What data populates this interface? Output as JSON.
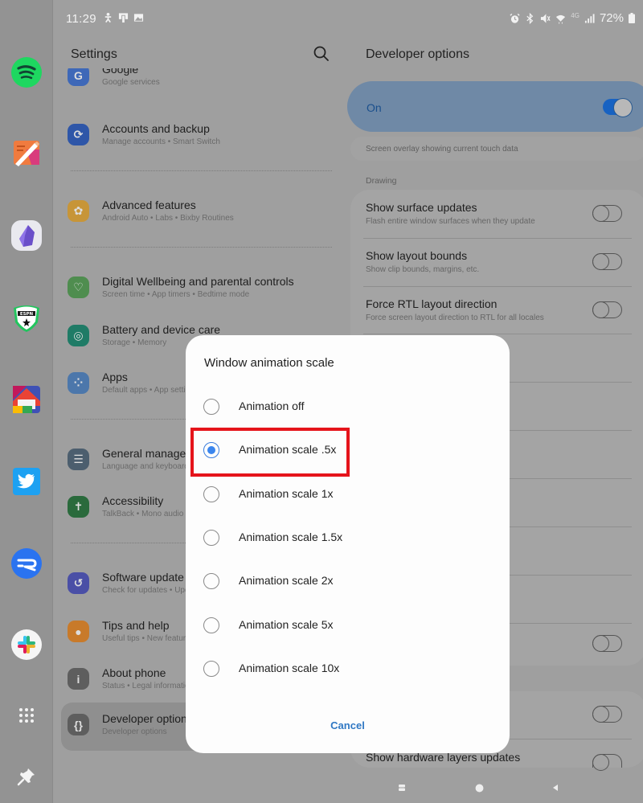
{
  "status_bar": {
    "time": "11:29",
    "left_icons": [
      "accessibility-notification-icon",
      "device-notification-icon",
      "gallery-notification-icon"
    ],
    "right_icons": [
      "alarm-icon",
      "bluetooth-icon",
      "mute-icon",
      "wifi-icon",
      "4g-icon",
      "signal-icon"
    ],
    "network_label": "4G",
    "battery": "72%"
  },
  "taskbar": {
    "apps": [
      {
        "name": "spotify",
        "icon": "spotify-icon",
        "color": "#1ed760"
      },
      {
        "name": "notes",
        "icon": "notes-pencil-icon",
        "color": "#f07b3f"
      },
      {
        "name": "obsidian",
        "icon": "obsidian-icon",
        "color": "#7c5cd6"
      },
      {
        "name": "espn-fantasy",
        "icon": "espn-shield-icon",
        "color": "#e8eaf0"
      },
      {
        "name": "home-launcher",
        "icon": "home-icon",
        "color": "#e94335"
      },
      {
        "name": "twitter",
        "icon": "twitter-bird-icon",
        "color": "#1da1f2"
      },
      {
        "name": "relay",
        "icon": "relay-r-icon",
        "color": "#2a73f0"
      },
      {
        "name": "slack",
        "icon": "slack-icon",
        "color": "#ffffff"
      }
    ],
    "all_apps_icon": "app-grid-icon",
    "pin_icon": "pin-icon"
  },
  "settings": {
    "title": "Settings",
    "search_icon": "search-icon",
    "items": [
      {
        "title": "Google",
        "subtitle": "Google services",
        "icon": "google-icon",
        "color": "#3e68b8"
      },
      {
        "title": "Accounts and backup",
        "subtitle": "Manage accounts  •  Smart Switch",
        "icon": "sync-icon",
        "color": "#2e56a8"
      },
      {
        "title": "Advanced features",
        "subtitle": "Android Auto  •  Labs  •  Bixby Routines",
        "icon": "gear-plus-icon",
        "color": "#c79538"
      },
      {
        "title": "Digital Wellbeing and parental controls",
        "subtitle": "Screen time  •  App timers  •  Bedtime mode",
        "icon": "wellbeing-icon",
        "color": "#4f8d4f"
      },
      {
        "title": "Battery and device care",
        "subtitle": "Storage  •  Memory",
        "icon": "device-care-icon",
        "color": "#1f7b66"
      },
      {
        "title": "Apps",
        "subtitle": "Default apps  •  App settings",
        "icon": "apps-icon",
        "color": "#4c77ab"
      },
      {
        "title": "General management",
        "subtitle": "Language and keyboard",
        "icon": "sliders-icon",
        "color": "#4c5e6e"
      },
      {
        "title": "Accessibility",
        "subtitle": "TalkBack  •  Mono audio",
        "icon": "accessibility-icon",
        "color": "#2a6a3c"
      },
      {
        "title": "Software update",
        "subtitle": "Check for updates  •  Update",
        "icon": "software-update-icon",
        "color": "#4a4fa6"
      },
      {
        "title": "Tips and help",
        "subtitle": "Useful tips  •  New features",
        "icon": "lightbulb-icon",
        "color": "#c87a2a"
      },
      {
        "title": "About phone",
        "subtitle": "Status  •  Legal information",
        "icon": "info-icon",
        "color": "#5e5e5e"
      },
      {
        "title": "Developer options",
        "subtitle": "Developer options",
        "icon": "braces-icon",
        "color": "#5e5e5e"
      }
    ]
  },
  "developer_options": {
    "title": "Developer options",
    "master_toggle": {
      "label": "On",
      "checked": true
    },
    "partial_row_subtitle": "Screen overlay showing current touch data",
    "section_drawing": "Drawing",
    "rows": [
      {
        "title": "Show surface updates",
        "subtitle": "Flash entire window surfaces when they update",
        "checked": false
      },
      {
        "title": "Show layout bounds",
        "subtitle": "Show clip bounds, margins, etc.",
        "checked": false
      },
      {
        "title": "Force RTL layout direction",
        "subtitle": "Force screen layout direction to RTL for all locales",
        "checked": false
      }
    ],
    "bottom_row": {
      "title": "Show hardware layers updates",
      "checked": false
    }
  },
  "dialog": {
    "title": "Window animation scale",
    "options": [
      {
        "label": "Animation off",
        "selected": false
      },
      {
        "label": "Animation scale .5x",
        "selected": true
      },
      {
        "label": "Animation scale 1x",
        "selected": false
      },
      {
        "label": "Animation scale 1.5x",
        "selected": false
      },
      {
        "label": "Animation scale 2x",
        "selected": false
      },
      {
        "label": "Animation scale 5x",
        "selected": false
      },
      {
        "label": "Animation scale 10x",
        "selected": false
      }
    ],
    "cancel_label": "Cancel",
    "highlight_color": "#e5141b",
    "accent_color": "#3b86ee"
  },
  "nav_bar": {
    "recents_icon": "recents-icon",
    "home_icon": "home-circle-icon",
    "back_icon": "back-triangle-icon"
  }
}
